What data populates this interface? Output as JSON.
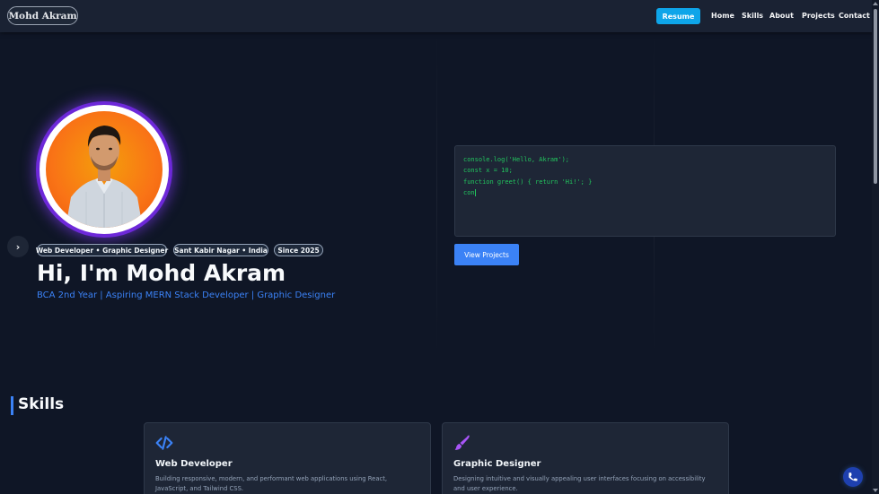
{
  "navbar": {
    "logo": "Mohd Akram",
    "resume_label": "Resume",
    "links": [
      "Home",
      "Skills",
      "About",
      "Projects",
      "Contact"
    ]
  },
  "hero": {
    "badges": [
      "Web Developer • Graphic Designer",
      "Sant Kabir Nagar • India",
      "Since 2025"
    ],
    "title": "Hi, I'm Mohd Akram",
    "subtitle": "BCA 2nd Year | Aspiring MERN Stack Developer | Graphic Designer",
    "side_arrow_icon": "chevron-right-icon"
  },
  "code": {
    "lines": [
      "console.log('Hello, Akram');",
      "const x = 10;",
      "function greet() { return 'Hi!'; }",
      "con"
    ]
  },
  "view_projects_label": "View Projects",
  "skills": {
    "title": "Skills",
    "cards": [
      {
        "icon": "code-icon",
        "title": "Web Developer",
        "description": "Building responsive, modern, and performant web applications using React, JavaScript, and Tailwind CSS."
      },
      {
        "icon": "paintbrush-icon",
        "title": "Graphic Designer",
        "description": "Designing intuitive and visually appealing user interfaces focusing on accessibility and user experience."
      }
    ]
  },
  "floating": {
    "icon": "phone-icon"
  },
  "colors": {
    "background": "#0f1626",
    "navbar": "#1a2233",
    "accent_blue": "#3b82f6",
    "resume_button": "#0ea5e9",
    "code_green": "#22c55e",
    "avatar_ring": "#6d28d9"
  }
}
